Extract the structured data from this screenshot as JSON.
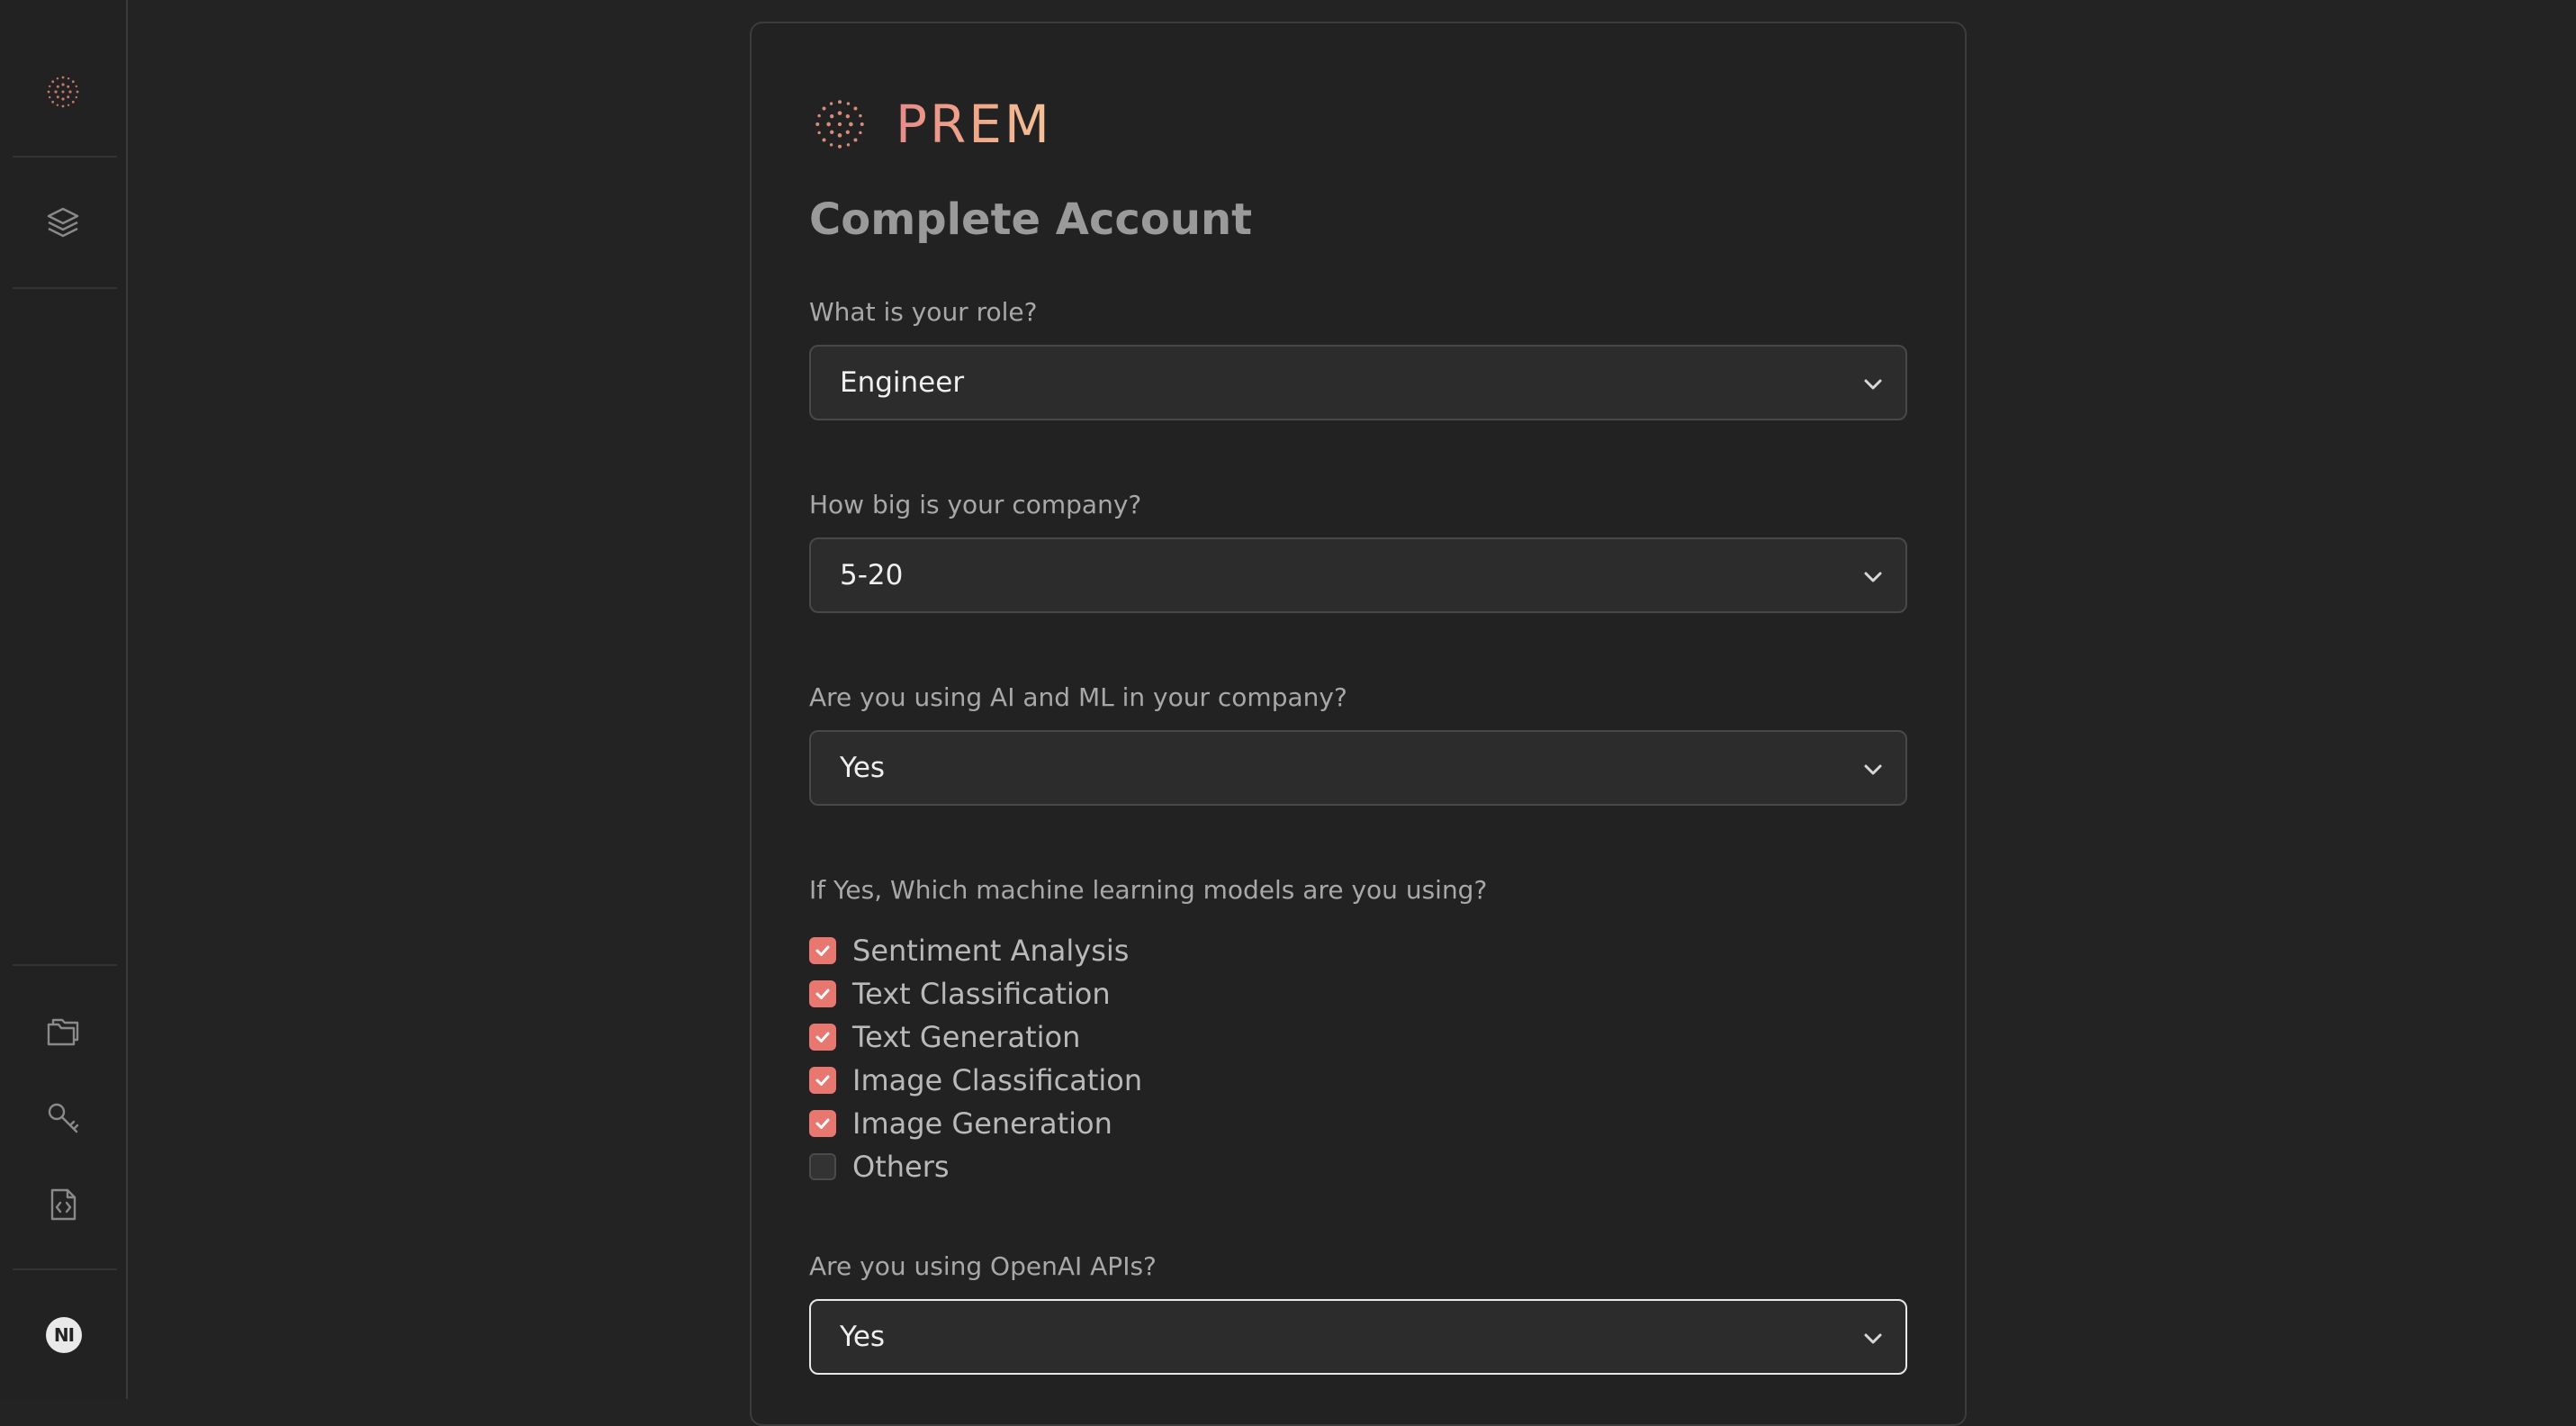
{
  "sidebar": {
    "top_icons": [
      "prem-logo-icon",
      "layers-icon"
    ],
    "bottom_icons": [
      "folders-icon",
      "key-icon",
      "code-file-icon"
    ],
    "avatar_initials": "NI"
  },
  "brand": {
    "name": "PREM",
    "colors": [
      "#e88a8a",
      "#f4c39a"
    ]
  },
  "form": {
    "title": "Complete Account",
    "role": {
      "label": "What is your role?",
      "value": "Engineer"
    },
    "company_size": {
      "label": "How big is your company?",
      "value": "5-20"
    },
    "using_ai": {
      "label": "Are you using AI and ML in your company?",
      "value": "Yes"
    },
    "models": {
      "label": "If Yes, Which machine learning models are you using?",
      "options": [
        {
          "label": "Sentiment Analysis",
          "checked": true
        },
        {
          "label": "Text Classification",
          "checked": true
        },
        {
          "label": "Text Generation",
          "checked": true
        },
        {
          "label": "Image Classification",
          "checked": true
        },
        {
          "label": "Image Generation",
          "checked": true
        },
        {
          "label": "Others",
          "checked": false
        }
      ]
    },
    "openai": {
      "label": "Are you using OpenAI APIs?",
      "value": "Yes"
    }
  },
  "colors": {
    "accent": "#e8776f",
    "background": "#232323"
  }
}
